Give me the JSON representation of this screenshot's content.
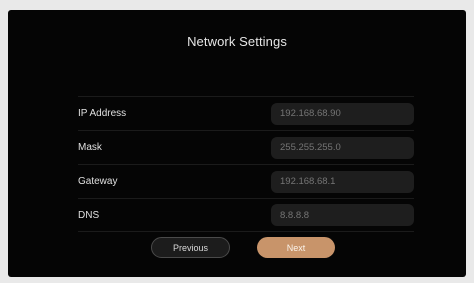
{
  "header": {
    "title": "Network Settings"
  },
  "form": {
    "ip_address": {
      "label": "IP Address",
      "value": "",
      "placeholder": "192.168.68.90"
    },
    "mask": {
      "label": "Mask",
      "value": "",
      "placeholder": "255.255.255.0"
    },
    "gateway": {
      "label": "Gateway",
      "value": "",
      "placeholder": "192.168.68.1"
    },
    "dns": {
      "label": "DNS",
      "value": "",
      "placeholder": "8.8.8.8"
    }
  },
  "buttons": {
    "previous_label": "Previous",
    "next_label": "Next"
  },
  "colors": {
    "background": "#050505",
    "field_background": "#1e1e1e",
    "accent": "#c8946a"
  }
}
